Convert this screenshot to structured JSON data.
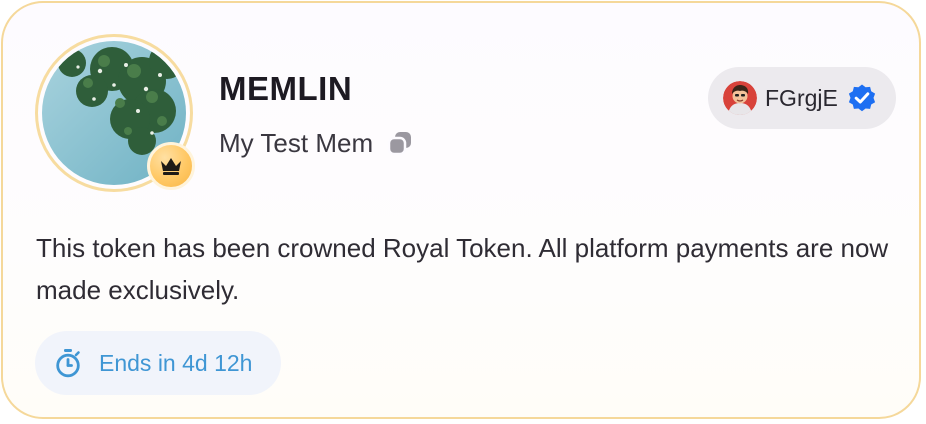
{
  "token": {
    "name": "MEMLIN",
    "description_line": "My Test Mem",
    "avatar_icon": "leafy-tree-photo",
    "badge_icon": "crown-icon"
  },
  "creator": {
    "username": "FGrgjE",
    "verified": true,
    "verified_color": "#1d6ff2",
    "avatar_icon": "user-avatar-icon"
  },
  "message": "This token has been crowned Royal Token. All platform payments are now made exclusively.",
  "timer": {
    "label": "Ends in 4d 12h",
    "icon": "stopwatch-icon",
    "color": "#3f96d4"
  },
  "colors": {
    "card_border": "#f5d89a",
    "crown_badge": "#ffc864",
    "pill_background": "#eceaee",
    "timer_background": "#f1f4fb"
  }
}
